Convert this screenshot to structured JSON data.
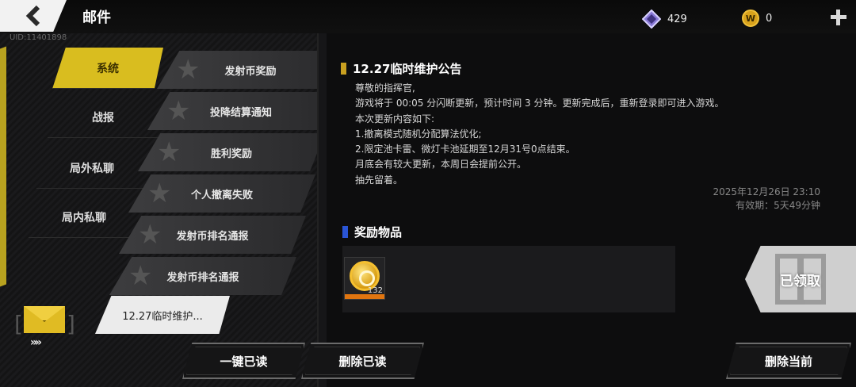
{
  "header": {
    "title": "邮件",
    "uid": "UID:11401898",
    "currencies": [
      {
        "name": "diamond",
        "icon": "crystal-icon",
        "value": "429"
      },
      {
        "name": "coin",
        "icon": "w-coin-icon",
        "value": "0",
        "symbol": "W"
      }
    ]
  },
  "categories": [
    {
      "label": "系统",
      "active": true
    },
    {
      "label": "战报",
      "active": false
    },
    {
      "label": "局外私聊",
      "active": false
    },
    {
      "label": "局内私聊",
      "active": false
    }
  ],
  "mails": [
    {
      "label": "发射币奖励"
    },
    {
      "label": "投降结算通知"
    },
    {
      "label": "胜利奖励"
    },
    {
      "label": "个人撤离失败"
    },
    {
      "label": "发射币排名通报"
    },
    {
      "label": "发射币排名通报"
    },
    {
      "label": "12.27临时维护...",
      "selected": true
    }
  ],
  "notice": {
    "title": "12.27临时维护公告",
    "lines": [
      "尊敬的指挥官,",
      "游戏将于 00:05 分闪断更新，预计时间 3 分钟。更新完成后，重新登录即可进入游戏。",
      "本次更新内容如下:",
      "1.撤离模式随机分配算法优化;",
      "2.限定池卡雷、微灯卡池延期至12月31号0点结束。",
      "月底会有较大更新，本周日会提前公开。",
      "抽先留着。"
    ],
    "date": "2025年12月26日  23:10",
    "validity": "有效期：5天49分钟"
  },
  "reward": {
    "title": "奖励物品",
    "items": [
      {
        "icon": "launch-coin-icon",
        "count": "132"
      }
    ],
    "claimed_label": "已领取"
  },
  "buttons": {
    "read_all": "一键已读",
    "delete_read": "删除已读",
    "delete_current": "删除当前"
  },
  "colors": {
    "accent_yellow": "#d9bd1f",
    "reward_blue": "#2a55d6"
  }
}
